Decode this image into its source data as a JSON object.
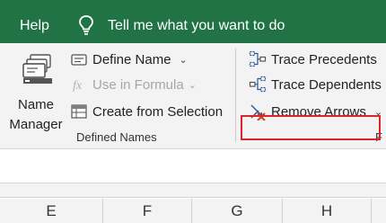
{
  "tabbar": {
    "help_label": "Help",
    "tell_me_text": "Tell me what you want to do",
    "tell_me_icon": "lightbulb-icon"
  },
  "ribbon": {
    "defined_names": {
      "name_manager": {
        "line1": "Name",
        "line2": "Manager",
        "icon": "name-manager-icon"
      },
      "define_name": {
        "label": "Define Name",
        "icon": "define-name-icon",
        "caret": "⌄"
      },
      "use_in_formula": {
        "label": "Use in Formula",
        "icon": "fx-icon",
        "caret": "⌄",
        "enabled": false
      },
      "create_from_selection": {
        "label": "Create from Selection",
        "icon": "create-from-selection-icon"
      },
      "group_label": "Defined Names"
    },
    "formula_auditing": {
      "trace_precedents": {
        "label": "Trace Precedents",
        "icon": "trace-precedents-icon"
      },
      "trace_dependents": {
        "label": "Trace Dependents",
        "icon": "trace-dependents-icon",
        "highlighted": true
      },
      "remove_arrows": {
        "label": "Remove Arrows",
        "icon": "remove-arrows-icon",
        "caret": "⌄"
      },
      "group_label_partial": "F"
    }
  },
  "columns": [
    "E",
    "F",
    "G",
    "H"
  ],
  "colors": {
    "tabbar_bg": "#217346",
    "ribbon_bg": "#f3f3f3",
    "highlight_border": "#d9262b"
  }
}
